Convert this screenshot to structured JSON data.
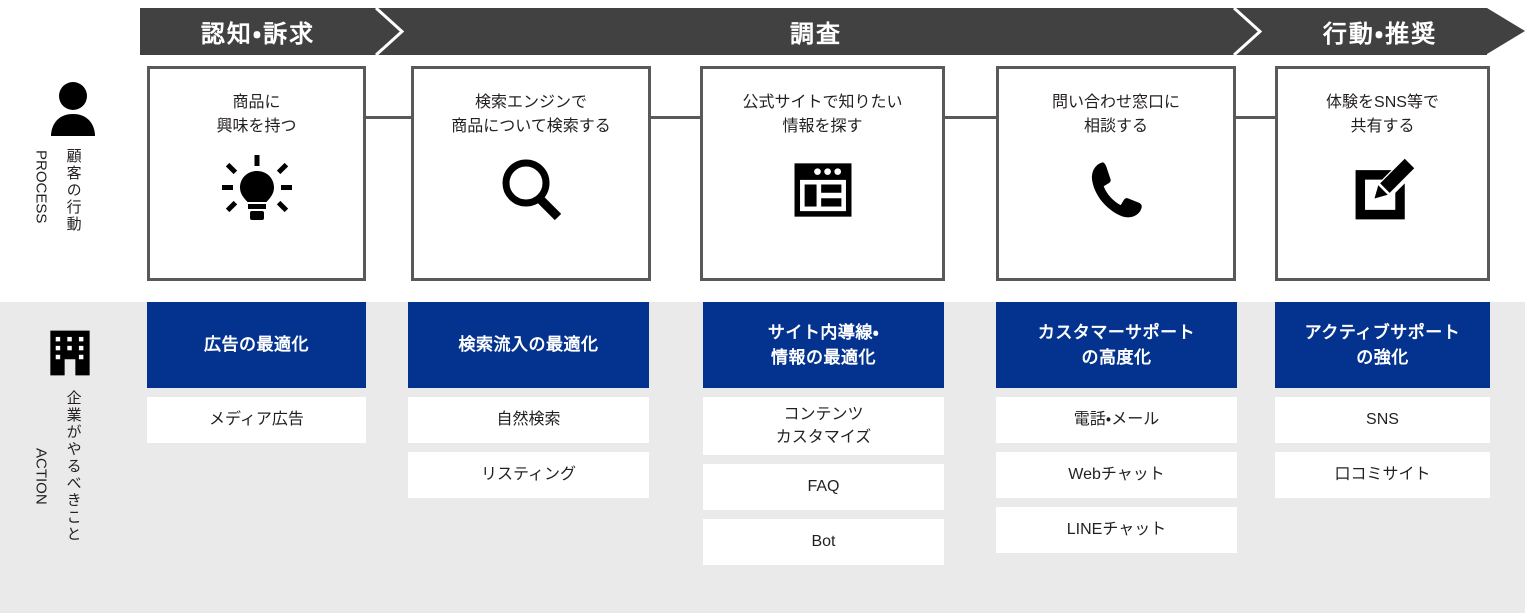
{
  "colors": {
    "stage_bar": "#414141",
    "action_head": "#04338f",
    "band_action_bg": "#eaeaea",
    "box_border": "#595959",
    "text": "#231f20",
    "white": "#ffffff"
  },
  "stages": [
    {
      "label": "認知・訴求"
    },
    {
      "label": "調査"
    },
    {
      "label": "行動・推奨"
    }
  ],
  "rows": [
    {
      "icon": "person-icon",
      "label_ja": "顧客の行動",
      "label_en": "PROCESS"
    },
    {
      "icon": "building-icon",
      "label_ja": "企業がやるべきこと",
      "label_en": "ACTION"
    }
  ],
  "process": [
    {
      "title": "商品に\n興味を持つ",
      "icon": "lightbulb-icon"
    },
    {
      "title": "検索エンジンで\n商品について検索する",
      "icon": "magnifier-icon"
    },
    {
      "title": "公式サイトで知りたい\n情報を探す",
      "icon": "browser-window-icon"
    },
    {
      "title": "問い合わせ窓口に\n相談する",
      "icon": "phone-icon"
    },
    {
      "title": "体験をSNS等で\n共有する",
      "icon": "edit-square-icon"
    }
  ],
  "action": [
    {
      "head": "広告の最適化",
      "items": [
        "メディア広告"
      ]
    },
    {
      "head": "検索流入の最適化",
      "items": [
        "自然検索",
        "リスティング"
      ]
    },
    {
      "head": "サイト内導線・\n情報の最適化",
      "items": [
        "コンテンツ\nカスタマイズ",
        "FAQ",
        "Bot"
      ]
    },
    {
      "head": "カスタマーサポート\nの高度化",
      "items": [
        "電話・メール",
        "Webチャット",
        "LINEチャット"
      ]
    },
    {
      "head": "アクティブサポート\nの強化",
      "items": [
        "SNS",
        "口コミサイト"
      ]
    }
  ]
}
